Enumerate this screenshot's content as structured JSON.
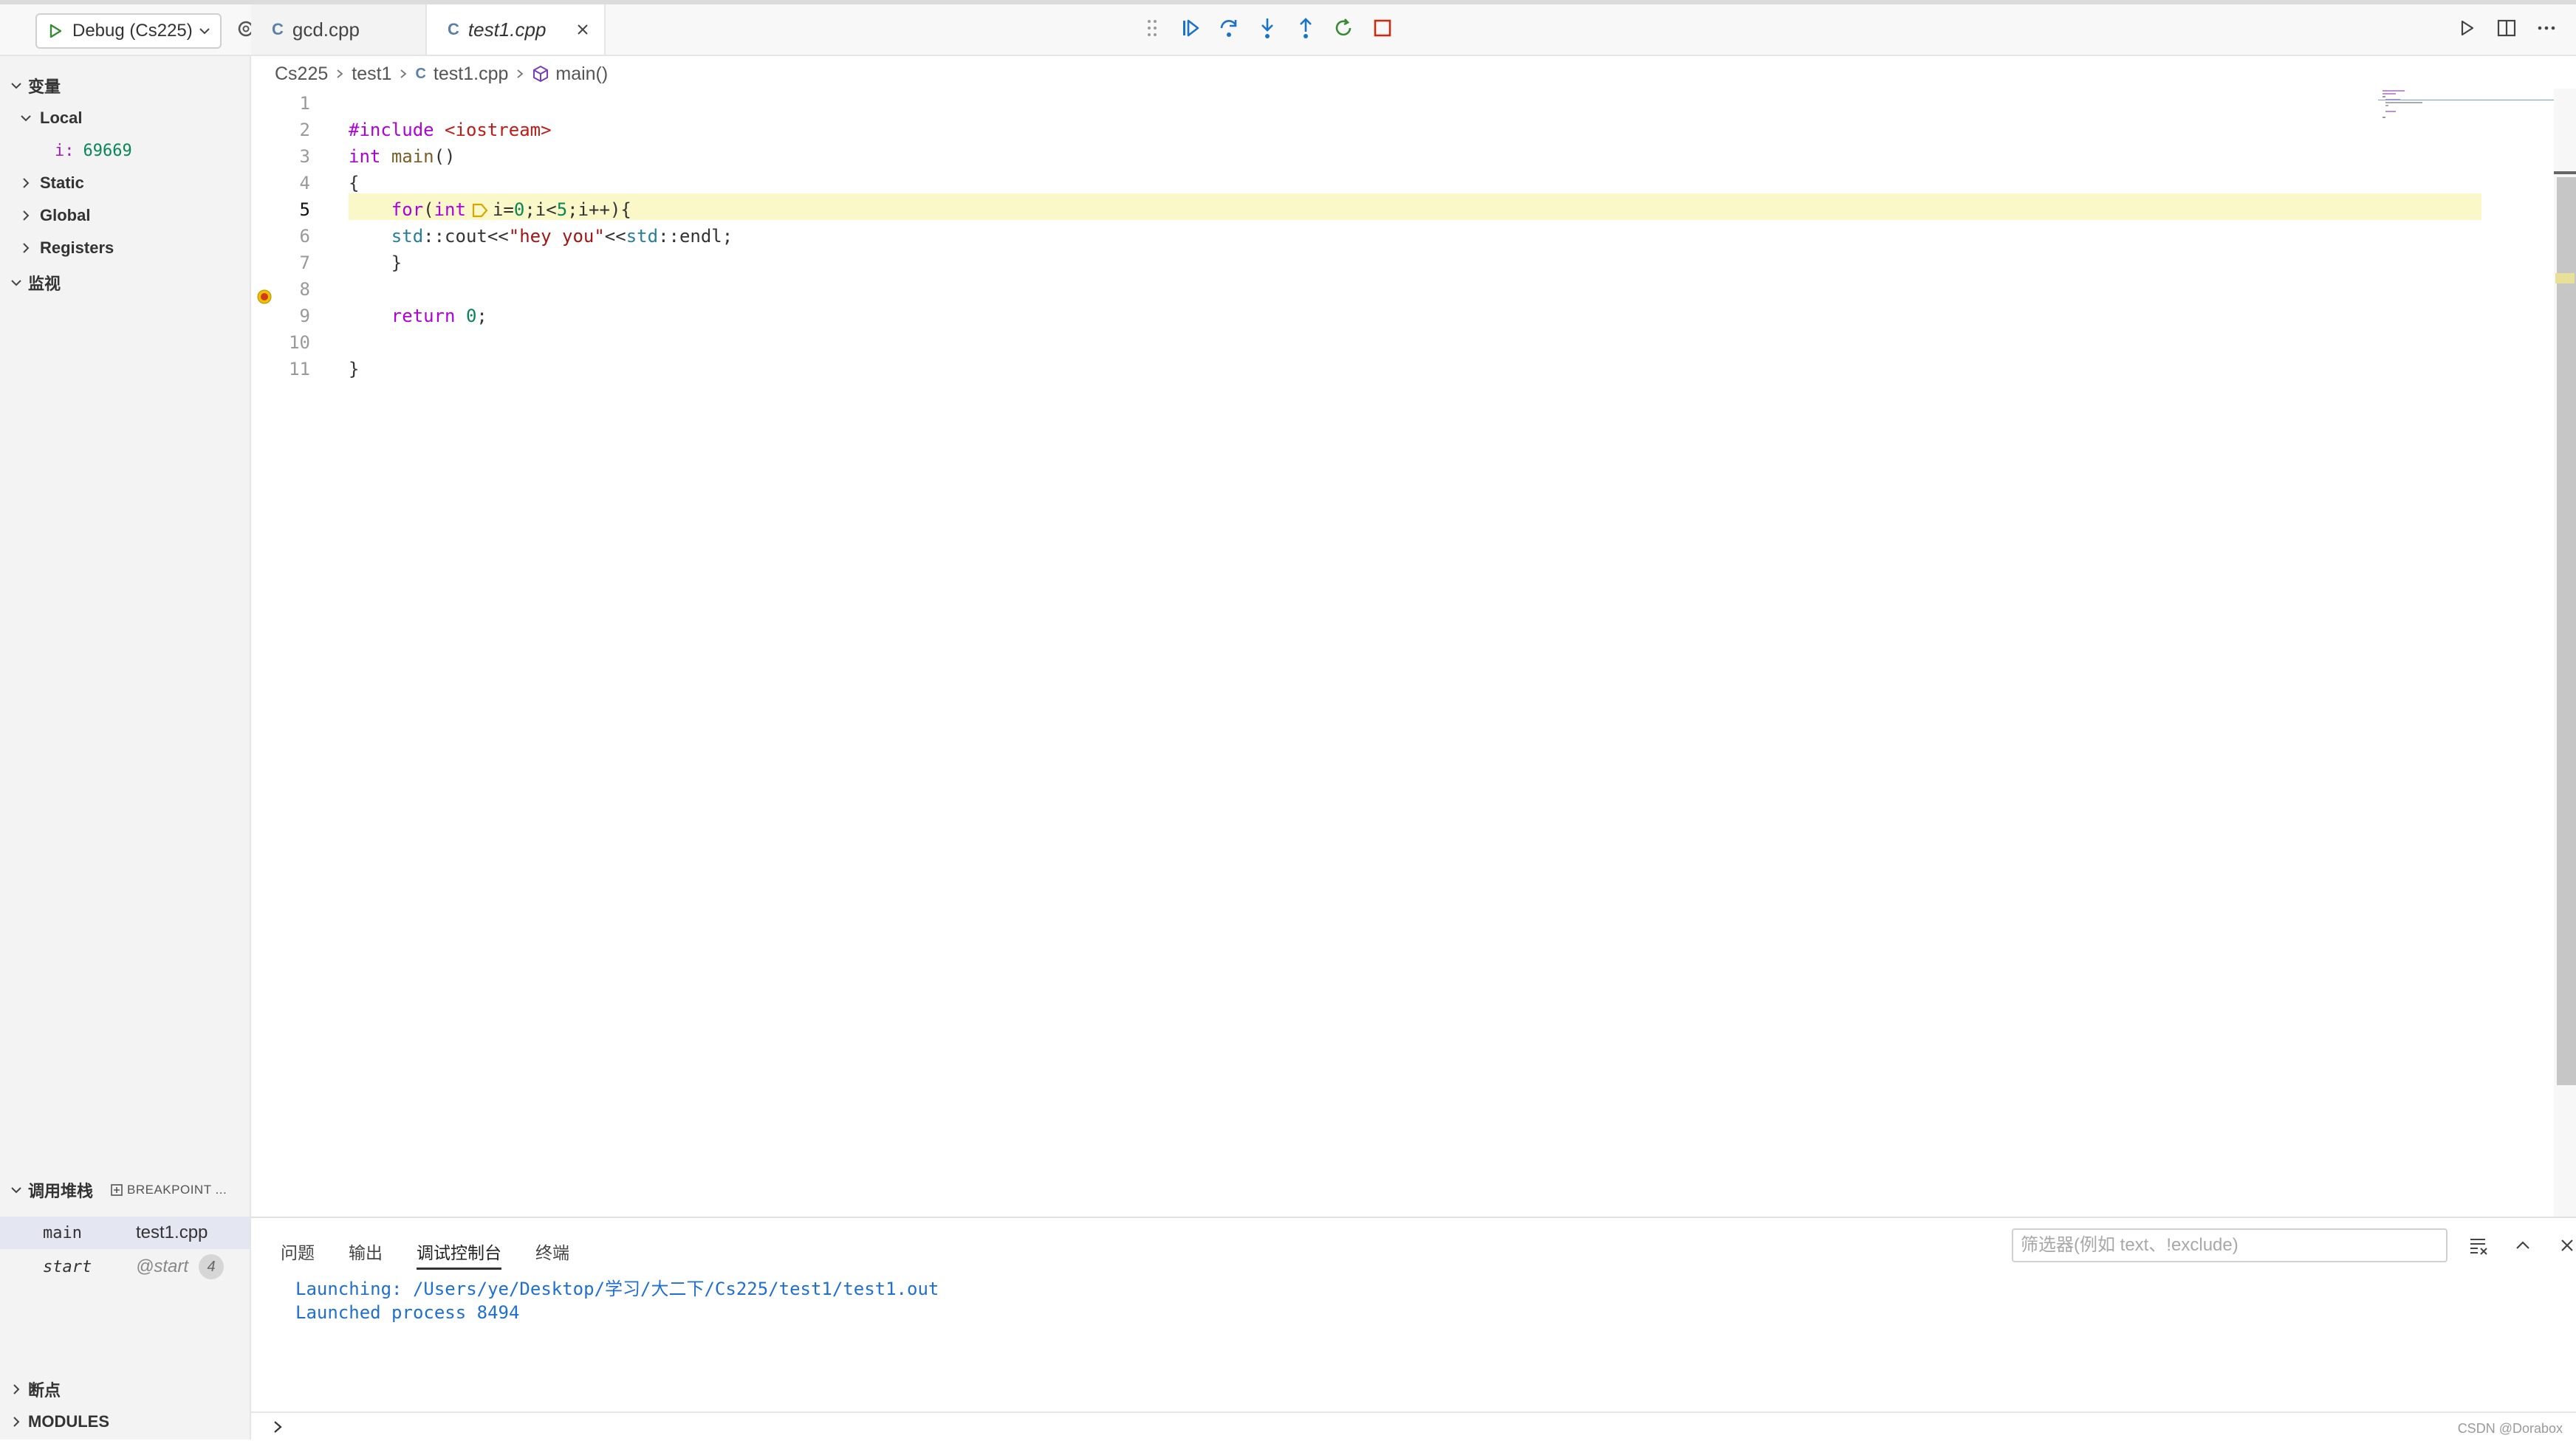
{
  "colors": {
    "accent": "#1f6fd1",
    "debug_green": "#388a34",
    "stop_red": "#c72e0f",
    "highlight_line": "#faf8c8",
    "keyword": "#af00db",
    "string": "#a31515",
    "number": "#098658"
  },
  "topbar": {
    "debug_config": "Debug (Cs225)",
    "tabs": [
      {
        "label": "gcd.cpp",
        "icon": "cpp-file-icon",
        "active": false
      },
      {
        "label": "test1.cpp",
        "icon": "cpp-file-icon",
        "active": true
      }
    ],
    "debug_toolbar": [
      "drag-handle-icon",
      "continue-icon",
      "step-over-icon",
      "step-into-icon",
      "step-out-icon",
      "restart-icon",
      "stop-icon"
    ],
    "right_actions": [
      "run-icon",
      "split-editor-icon",
      "more-icon"
    ]
  },
  "file_icon_glyph": "C",
  "sidebar": {
    "variables": {
      "title": "变量",
      "local_label": "Local",
      "local_var_name": "i:",
      "local_var_value": "69669",
      "groups": [
        "Static",
        "Global",
        "Registers"
      ]
    },
    "watch": {
      "title": "监视"
    },
    "call_stack": {
      "title": "调用堆栈",
      "breakpoint_tab": "BREAKPOINT ...",
      "frames": [
        {
          "function": "main",
          "source": "test1.cpp",
          "badge": ""
        },
        {
          "function": "start",
          "source": "@start",
          "badge": "4"
        }
      ]
    },
    "breakpoints": {
      "title": "断点"
    },
    "modules": {
      "title": "MODULES"
    }
  },
  "breadcrumb": {
    "items": [
      "Cs225",
      "test1",
      "test1.cpp",
      "main()"
    ]
  },
  "editor": {
    "current_line": 5,
    "lines": [
      {
        "n": "1",
        "text": ""
      },
      {
        "n": "2",
        "text": "#include <iostream>"
      },
      {
        "n": "3",
        "text": "int main()"
      },
      {
        "n": "4",
        "text": "{"
      },
      {
        "n": "5",
        "text": "    for(int i=0;i<5;i++){"
      },
      {
        "n": "6",
        "text": "    std::cout<<\"hey you\"<<std::endl;"
      },
      {
        "n": "7",
        "text": "    }"
      },
      {
        "n": "8",
        "text": ""
      },
      {
        "n": "9",
        "text": "    return 0;"
      },
      {
        "n": "10",
        "text": ""
      },
      {
        "n": "11",
        "text": "}"
      }
    ]
  },
  "panel": {
    "tabs": [
      "问题",
      "输出",
      "调试控制台",
      "终端"
    ],
    "active_tab": "调试控制台",
    "filter_placeholder": "筛选器(例如 text、!exclude)",
    "console_lines": [
      "Launching: /Users/ye/Desktop/学习/大二下/Cs225/test1/test1.out",
      "Launched process 8494"
    ]
  },
  "watermark": "CSDN @Dorabox"
}
